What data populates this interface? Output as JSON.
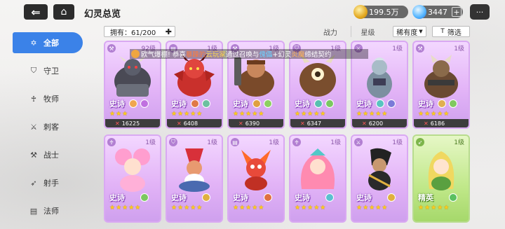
{
  "topbar": {
    "title": "幻灵总览",
    "back_icon": "back-arrow-icon",
    "home_icon": "home-icon",
    "gold": "199.5万",
    "gems": "3447",
    "gem_plus": "+",
    "chat_icon": "chat-bubble-icon"
  },
  "sidebar": {
    "items": [
      {
        "label": "全部",
        "icon": "star-outline-icon",
        "active": true
      },
      {
        "label": "守卫",
        "icon": "shield-icon",
        "active": false
      },
      {
        "label": "牧师",
        "icon": "priest-icon",
        "active": false
      },
      {
        "label": "刺客",
        "icon": "assassin-icon",
        "active": false
      },
      {
        "label": "战士",
        "icon": "warrior-icon",
        "active": false
      },
      {
        "label": "射手",
        "icon": "archer-icon",
        "active": false
      },
      {
        "label": "法师",
        "icon": "mage-book-icon",
        "active": false
      }
    ]
  },
  "filters": {
    "own_count": "拥有：61/200",
    "sort_power": "战力",
    "sort_level": "星级",
    "sort_rarity": "稀有度",
    "filter_label": "筛选"
  },
  "broadcast": {
    "p1": "欧气爆棚! 恭喜",
    "name": "暴躁的",
    "name2": "云玩家",
    "p2": "通过召唤与",
    "hero": "傀儡",
    "p3": "+幻灵",
    "hero2": "炎魔",
    "p4": "缔结契约"
  },
  "cards": {
    "row1": [
      {
        "level": "92级",
        "rarity": "史诗",
        "stars": "★★★",
        "power": "16225",
        "class": "warrior"
      },
      {
        "level": "1级",
        "rarity": "史诗",
        "stars": "★★★★★",
        "power": "6408",
        "class": "mage"
      },
      {
        "level": "1级",
        "rarity": "史诗",
        "stars": "★★★★★",
        "power": "6390",
        "class": "warrior"
      },
      {
        "level": "1级",
        "rarity": "史诗",
        "stars": "★★★★★",
        "power": "6347",
        "class": "guard"
      },
      {
        "level": "1级",
        "rarity": "史诗",
        "stars": "★★★★★",
        "power": "6200",
        "class": "assassin"
      },
      {
        "level": "1级",
        "rarity": "史诗",
        "stars": "★★★★★",
        "power": "6186",
        "class": "warrior"
      }
    ],
    "row2": [
      {
        "level": "1级",
        "rarity": "史诗",
        "stars": "★★★★★",
        "class": "priest",
        "tone": "purple"
      },
      {
        "level": "1级",
        "rarity": "史诗",
        "stars": "★★★★★",
        "class": "guard",
        "tone": "purple"
      },
      {
        "level": "1级",
        "rarity": "史诗",
        "stars": "★★★★★",
        "class": "mage",
        "tone": "purple"
      },
      {
        "level": "1级",
        "rarity": "史诗",
        "stars": "★★★★★",
        "class": "priest",
        "tone": "purple"
      },
      {
        "level": "1级",
        "rarity": "史诗",
        "stars": "★★★★★",
        "class": "assassin",
        "tone": "purple"
      },
      {
        "level": "1级",
        "rarity": "精英",
        "stars": "★★★★★",
        "class": "archer",
        "tone": "green"
      }
    ]
  },
  "colors": {
    "sidebar_active": "#3b82e8",
    "epic_card": "#e3b4f7",
    "elite_card": "#c0e889",
    "star": "#ffcc1a",
    "power_icon": "#ff5757"
  }
}
